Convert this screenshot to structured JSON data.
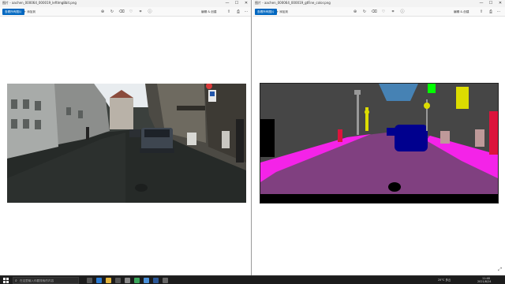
{
  "left_window": {
    "title": "图片 - aachen_000064_000019_leftImg8bit.png",
    "toolbar": {
      "primary_label": "查看所有图片",
      "add_label": "添加到",
      "edit_label": "编辑 & 创建",
      "icons": [
        "zoom-in-icon",
        "rotate-icon",
        "delete-icon",
        "favorite-icon",
        "crop-icon",
        "info-icon",
        "edit-icon",
        "share-icon",
        "print-icon",
        "more-icon"
      ]
    }
  },
  "right_window": {
    "title": "图片 - aachen_000064_000019_gtFine_color.png",
    "toolbar": {
      "primary_label": "查看所有图片",
      "add_label": "添加到",
      "edit_label": "编辑 & 创建"
    }
  },
  "window_controls": {
    "minimize": "—",
    "maximize": "☐",
    "close": "✕"
  },
  "taskbar": {
    "search_placeholder": "在这里输入你要搜索的内容",
    "weather": "25°C 多云",
    "time": "11:48",
    "date": "2021/8/24",
    "apps": [
      "task-view",
      "edge",
      "file-explorer",
      "store",
      "mail",
      "wechat",
      "photos",
      "word",
      "settings"
    ]
  },
  "colors": {
    "accent": "#0067c0",
    "seg_road": "#804080",
    "seg_sidewalk": "#f423e8",
    "seg_building": "#464646",
    "seg_car": "#00008e",
    "seg_sky": "#4682b4",
    "seg_person": "#dc143c",
    "seg_sign": "#dcdc00"
  }
}
